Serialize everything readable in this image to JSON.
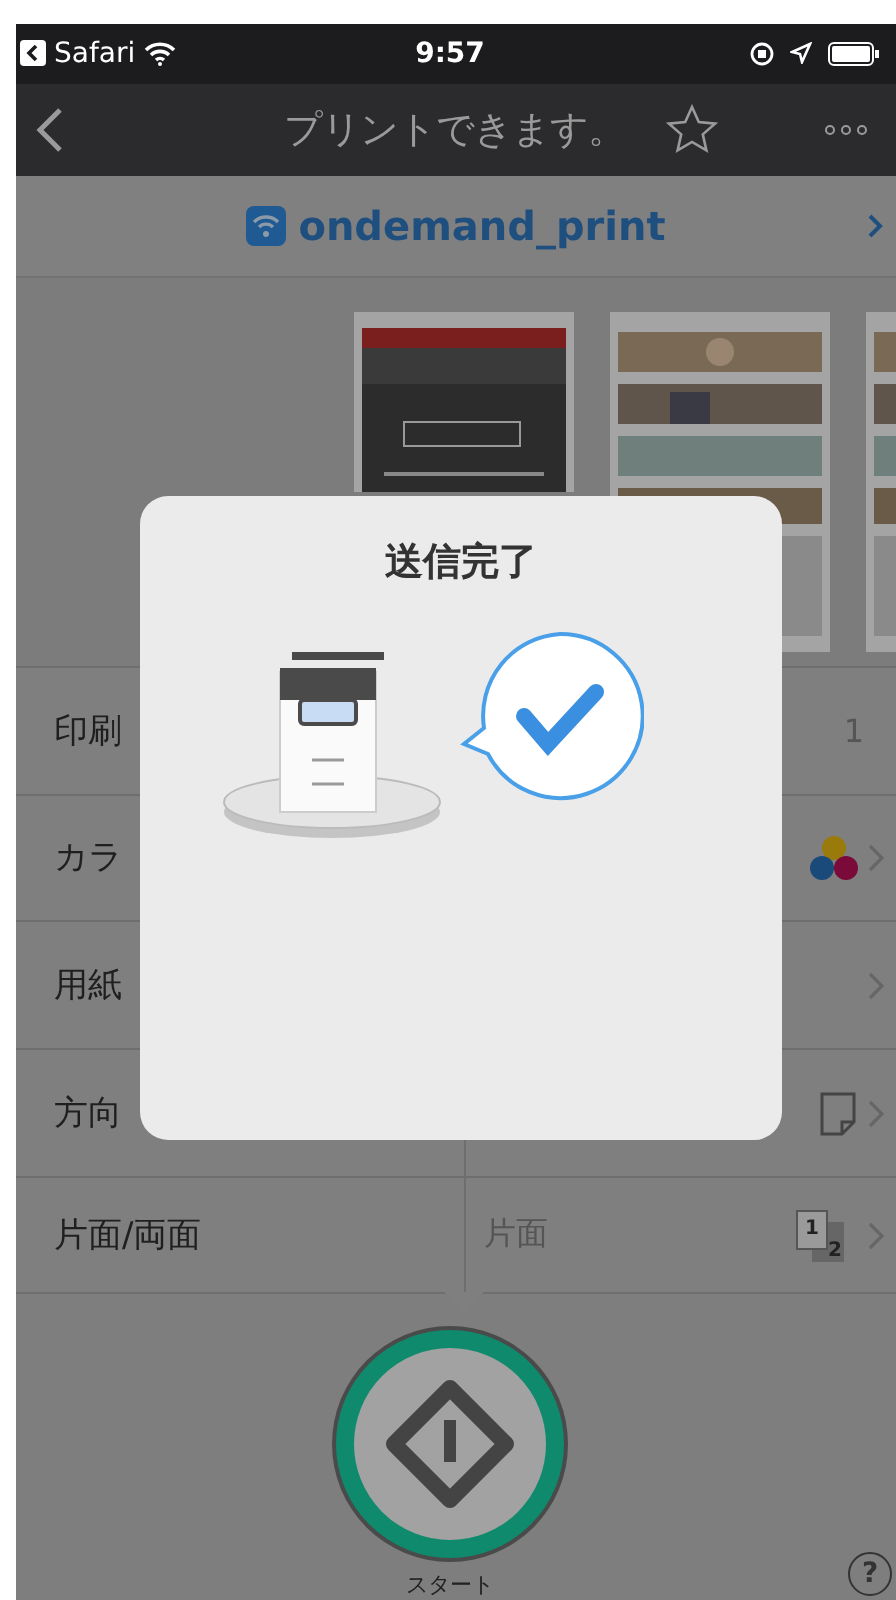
{
  "status_bar": {
    "back_app": "Safari",
    "time": "9:57"
  },
  "nav_bar": {
    "title": "プリントできます。"
  },
  "network": {
    "name": "ondemand_print"
  },
  "settings": [
    {
      "label": "印刷",
      "value": "1",
      "kind": "count"
    },
    {
      "label": "カラ",
      "kind": "color"
    },
    {
      "label": "用紙",
      "kind": "paper"
    },
    {
      "label": "方向",
      "kind": "orientation"
    },
    {
      "label": "片面/両面",
      "value": "片面",
      "kind": "duplex",
      "icon_front": "1",
      "icon_back": "2"
    }
  ],
  "dialog": {
    "title": "送信完了"
  },
  "start_button": {
    "label": "スタート"
  },
  "help": "?"
}
